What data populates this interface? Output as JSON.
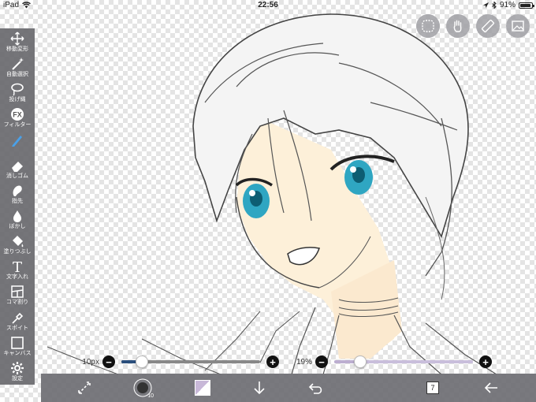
{
  "status_bar": {
    "device": "iPad",
    "time": "22:56",
    "battery": "91%",
    "battery_level": 0.91
  },
  "left_toolbar": {
    "tools": [
      {
        "label": "移動変形",
        "icon": "move-icon"
      },
      {
        "label": "自動選択",
        "icon": "magic-wand-icon"
      },
      {
        "label": "投げ縄",
        "icon": "lasso-icon"
      },
      {
        "label": "フィルター",
        "icon": "fx-icon",
        "glyph": "FX"
      },
      {
        "label": "ペン",
        "icon": "pen-icon",
        "active": true
      },
      {
        "label": "消しゴム",
        "icon": "eraser-icon"
      },
      {
        "label": "指先",
        "icon": "smudge-icon"
      },
      {
        "label": "ぼかし",
        "icon": "blur-drop-icon"
      },
      {
        "label": "塗りつぶし",
        "icon": "fill-bucket-icon"
      },
      {
        "label": "文字入れ",
        "icon": "text-icon",
        "glyph": "T"
      },
      {
        "label": "コマ割り",
        "icon": "panel-icon"
      },
      {
        "label": "スポイト",
        "icon": "eyedropper-icon"
      },
      {
        "label": "キャンバス",
        "icon": "canvas-icon"
      },
      {
        "label": "設定",
        "icon": "gear-icon"
      }
    ]
  },
  "top_buttons": [
    {
      "icon": "pattern-icon"
    },
    {
      "icon": "hand-icon"
    },
    {
      "icon": "ruler-icon"
    },
    {
      "icon": "gallery-icon"
    }
  ],
  "sliders": {
    "brush_size": {
      "label": "10px",
      "minus": "−",
      "plus": "+",
      "value": 0.15
    },
    "opacity": {
      "label": "19%",
      "minus": "−",
      "plus": "+",
      "value": 0.19
    }
  },
  "bottom_toolbar": {
    "items": [
      {
        "icon": "transform-arrows-icon"
      },
      {
        "icon": "brush-preview-icon",
        "value": "10"
      },
      {
        "icon": "color-swatch-icon"
      },
      {
        "icon": "download-arrow-icon"
      },
      {
        "icon": "undo-icon"
      },
      {
        "icon": "layers-icon",
        "value": "7"
      },
      {
        "icon": "back-arrow-icon"
      }
    ]
  },
  "colors": {
    "brush_slider": "#2a4e7c",
    "opacity_slider": "#bcaed0",
    "current_color": "#c8b8d8",
    "skin": "#fdf0d9",
    "eye": "#2fa6c2"
  }
}
